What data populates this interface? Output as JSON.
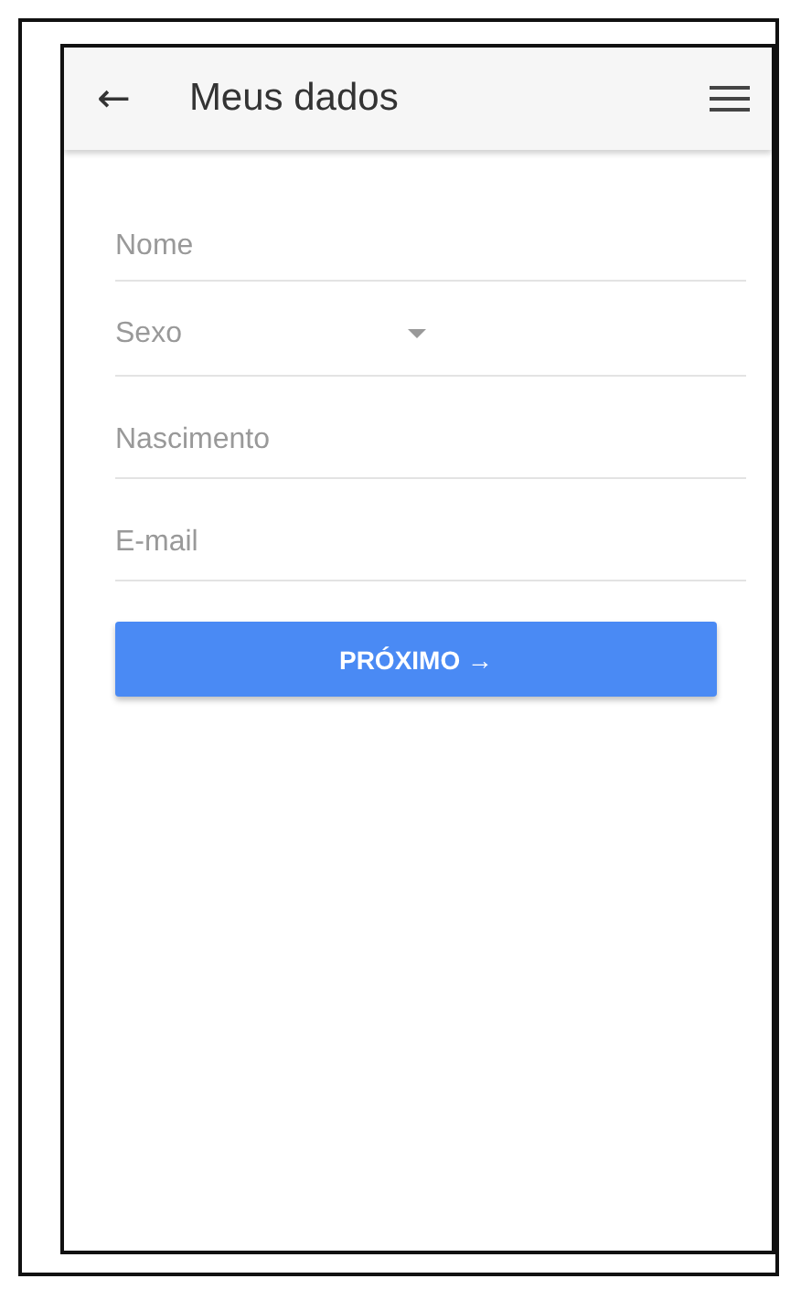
{
  "app_bar": {
    "back": "←",
    "title": "Meus dados"
  },
  "fields": [
    {
      "kind": "text",
      "placeholder": "Nome"
    },
    {
      "kind": "select",
      "placeholder": "Sexo"
    },
    {
      "kind": "text",
      "placeholder": "Nascimento"
    },
    {
      "kind": "text",
      "placeholder": "E-mail"
    }
  ],
  "button": {
    "label": "PRÓXIMO →"
  }
}
